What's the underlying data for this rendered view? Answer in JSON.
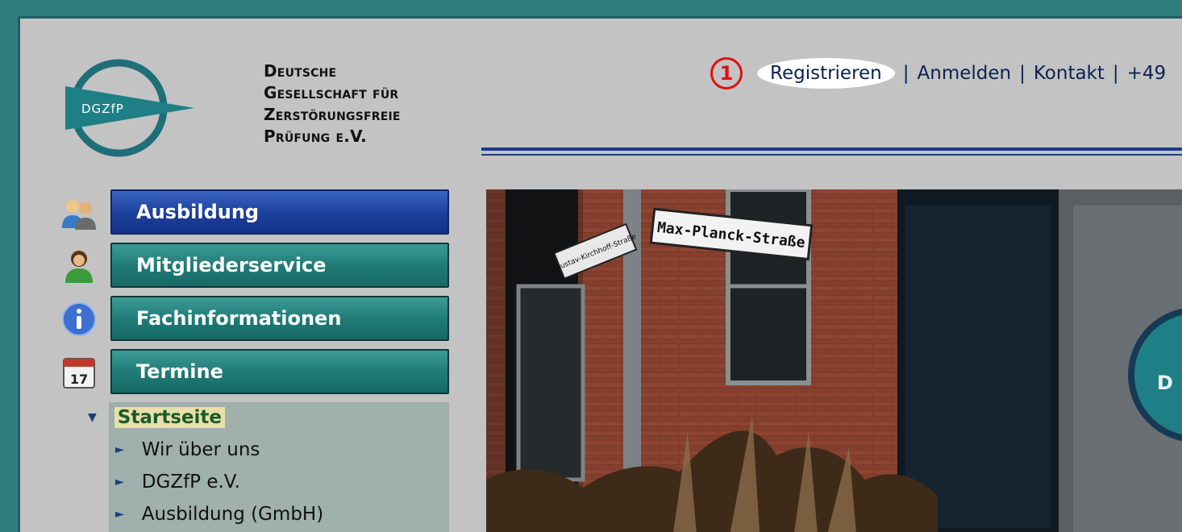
{
  "org": {
    "logo_text": "DGZfP",
    "name_lines": [
      "Deutsche",
      "Gesellschaft für",
      "Zerstörungsfreie",
      "Prüfung e.V."
    ]
  },
  "toplinks": {
    "marker": "1",
    "register": "Registrieren",
    "sep": "|",
    "login": "Anmelden",
    "contact": "Kontakt",
    "phone_partial": "+49"
  },
  "nav": [
    {
      "label": "Ausbildung",
      "icon": "people-icon",
      "style": "blue"
    },
    {
      "label": "Mitgliederservice",
      "icon": "person-icon",
      "style": "teal"
    },
    {
      "label": "Fachinformationen",
      "icon": "info-icon",
      "style": "teal"
    },
    {
      "label": "Termine",
      "icon": "calendar-icon",
      "style": "teal",
      "calendar_day": "17"
    }
  ],
  "subnav": {
    "current": "Startseite",
    "items": [
      "Wir über uns",
      "DGZfP e.V.",
      "Ausbildung (GmbH)"
    ]
  },
  "photo": {
    "sign_main": "Max-Planck-Straße",
    "sign_side": "Gustav-Kirchhoff-Straße",
    "logo_fragment": "D"
  },
  "colors": {
    "accent_red": "#e01010",
    "nav_blue": "#1b3f9a",
    "nav_teal": "#1f7975",
    "frame": "#2f7f7d"
  }
}
